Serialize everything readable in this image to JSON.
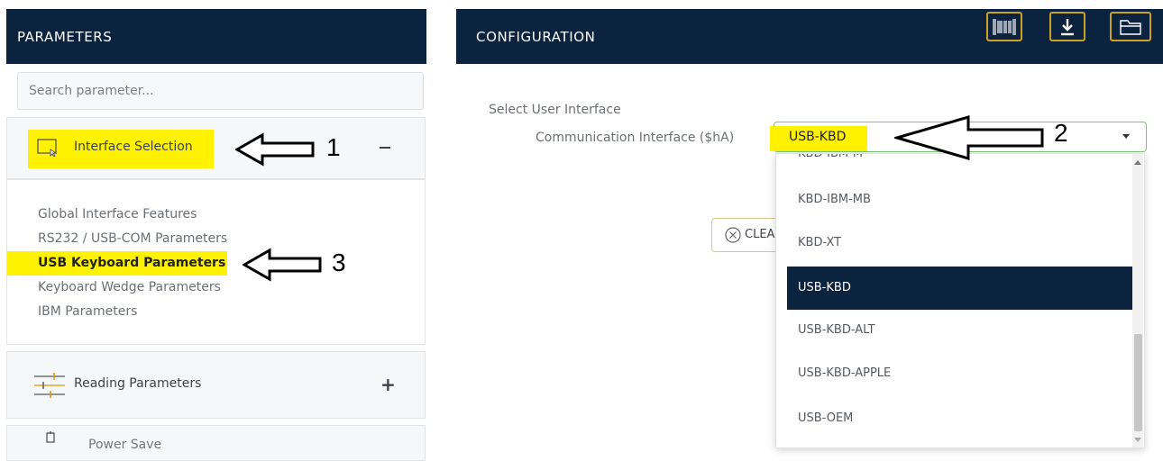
{
  "parameters_panel": {
    "title": "PARAMETERS",
    "search_placeholder": "Search parameter...",
    "interface_section": {
      "label": "Interface Selection",
      "toggle": "−",
      "items": [
        "Global Interface Features",
        "RS232 / USB-COM Parameters",
        "USB Keyboard Parameters",
        "Keyboard Wedge Parameters",
        "IBM Parameters"
      ],
      "active_item": "USB Keyboard Parameters"
    },
    "reading_section": {
      "label": "Reading Parameters",
      "toggle": "+"
    },
    "power_section": {
      "label": "Power Save"
    }
  },
  "configuration_panel": {
    "title": "CONFIGURATION",
    "header_icons": [
      "barcode-icon",
      "download-icon",
      "folder-icon"
    ],
    "group_label": "Select User Interface",
    "field_label": "Communication Interface ($hA)",
    "selected_value": "USB-KBD",
    "clear_label": "CLEA",
    "dropdown_options": [
      "KBD-IBM-M",
      "KBD-IBM-MB",
      "KBD-XT",
      "USB-KBD",
      "USB-KBD-ALT",
      "USB-KBD-APPLE",
      "USB-OEM"
    ]
  },
  "annotations": {
    "n1": "1",
    "n2": "2",
    "n3": "3"
  },
  "colors": {
    "header_bg": "#0c2340",
    "highlight": "#fff200",
    "select_border": "#7fc474",
    "button_border": "#c9a227"
  }
}
